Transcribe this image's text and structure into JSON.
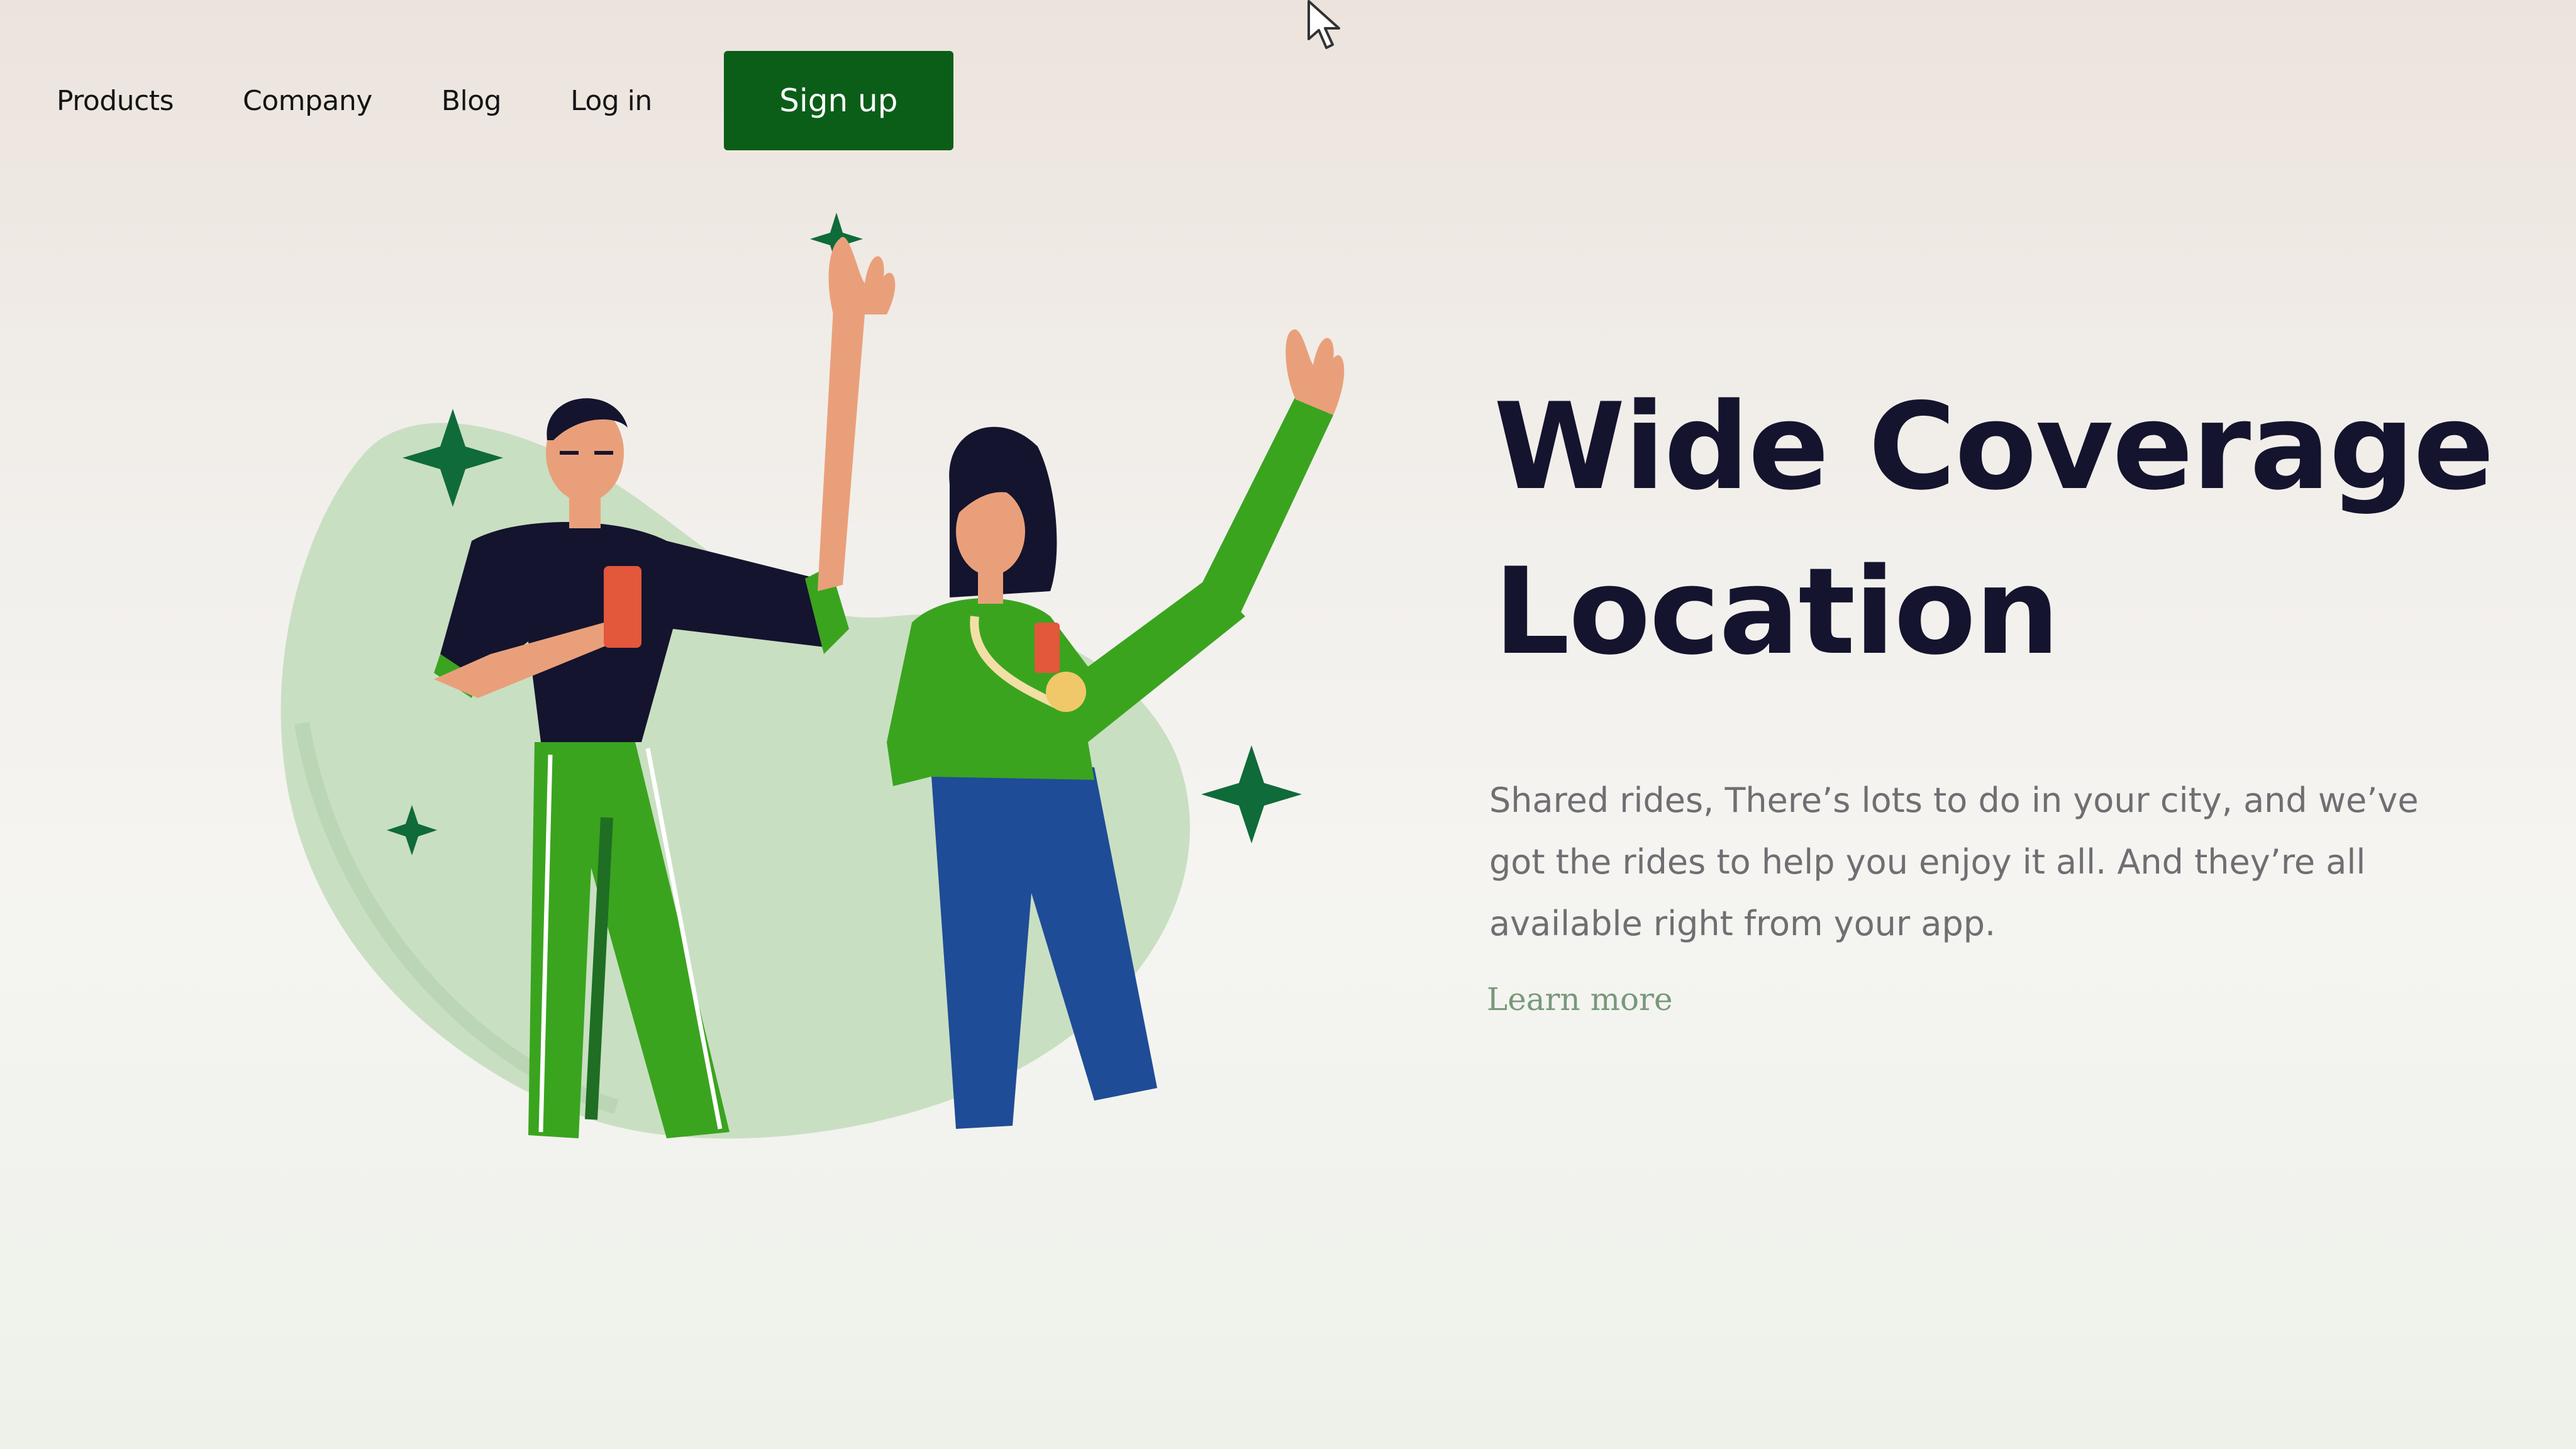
{
  "nav": {
    "links": [
      "Products",
      "Company",
      "Blog",
      "Log in"
    ],
    "signup_label": "Sign up"
  },
  "hero": {
    "title_line1": "Wide Coverage",
    "title_line2": "Location",
    "description": "Shared rides, There’s lots to do in your city, and we’ve got the rides to help you enjoy it all. And they’re all available right from your app.",
    "learn_more": "Learn more"
  },
  "colors": {
    "brand_green": "#0b5e17",
    "heading": "#14142e",
    "body_text": "#6f6f73",
    "blob": "#c9dfc2",
    "shirt_green": "#3aa41f",
    "sparkle": "#0f6b3a"
  },
  "icons": {
    "cursor": "mouse-pointer-icon",
    "sparkles": "sparkle-icon"
  }
}
